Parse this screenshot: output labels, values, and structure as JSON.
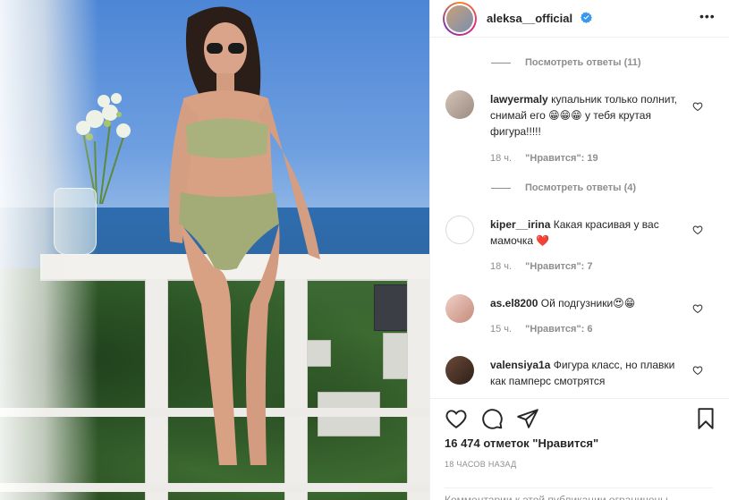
{
  "post": {
    "username": "aleksa__official",
    "more_icon": "more-dots-icon",
    "verified_icon": "verified-badge-icon"
  },
  "comments": [
    {
      "type": "replies",
      "label": "Посмотреть ответы (11)"
    },
    {
      "type": "comment",
      "user": "lawyermaly",
      "text": "купальник только полнит, снимай его 😁😁😁 у тебя крутая фигура!!!!!",
      "time": "18 ч.",
      "likes": "\"Нравится\": 19"
    },
    {
      "type": "replies",
      "label": "Посмотреть ответы (4)"
    },
    {
      "type": "comment",
      "user": "kiper__irina",
      "text": "Какая красивая у вас мамочка ❤️",
      "time": "18 ч.",
      "likes": "\"Нравится\": 7"
    },
    {
      "type": "comment",
      "user": "as.el8200",
      "text": "Ой подгузники😍😁",
      "time": "15 ч.",
      "likes": "\"Нравится\": 6"
    },
    {
      "type": "comment",
      "user": "valensiya1a",
      "text": "Фигура класс, но плавки как памперс смотрятся"
    }
  ],
  "actions": {
    "like_icon": "heart-icon",
    "comment_icon": "comment-bubble-icon",
    "share_icon": "paper-plane-icon",
    "save_icon": "bookmark-icon"
  },
  "likes_count": "16 474 отметок \"Нравится\"",
  "time_ago": "18 ЧАСОВ НАЗАД",
  "comment_input_text": "Комментарии к этой публикации ограничены."
}
